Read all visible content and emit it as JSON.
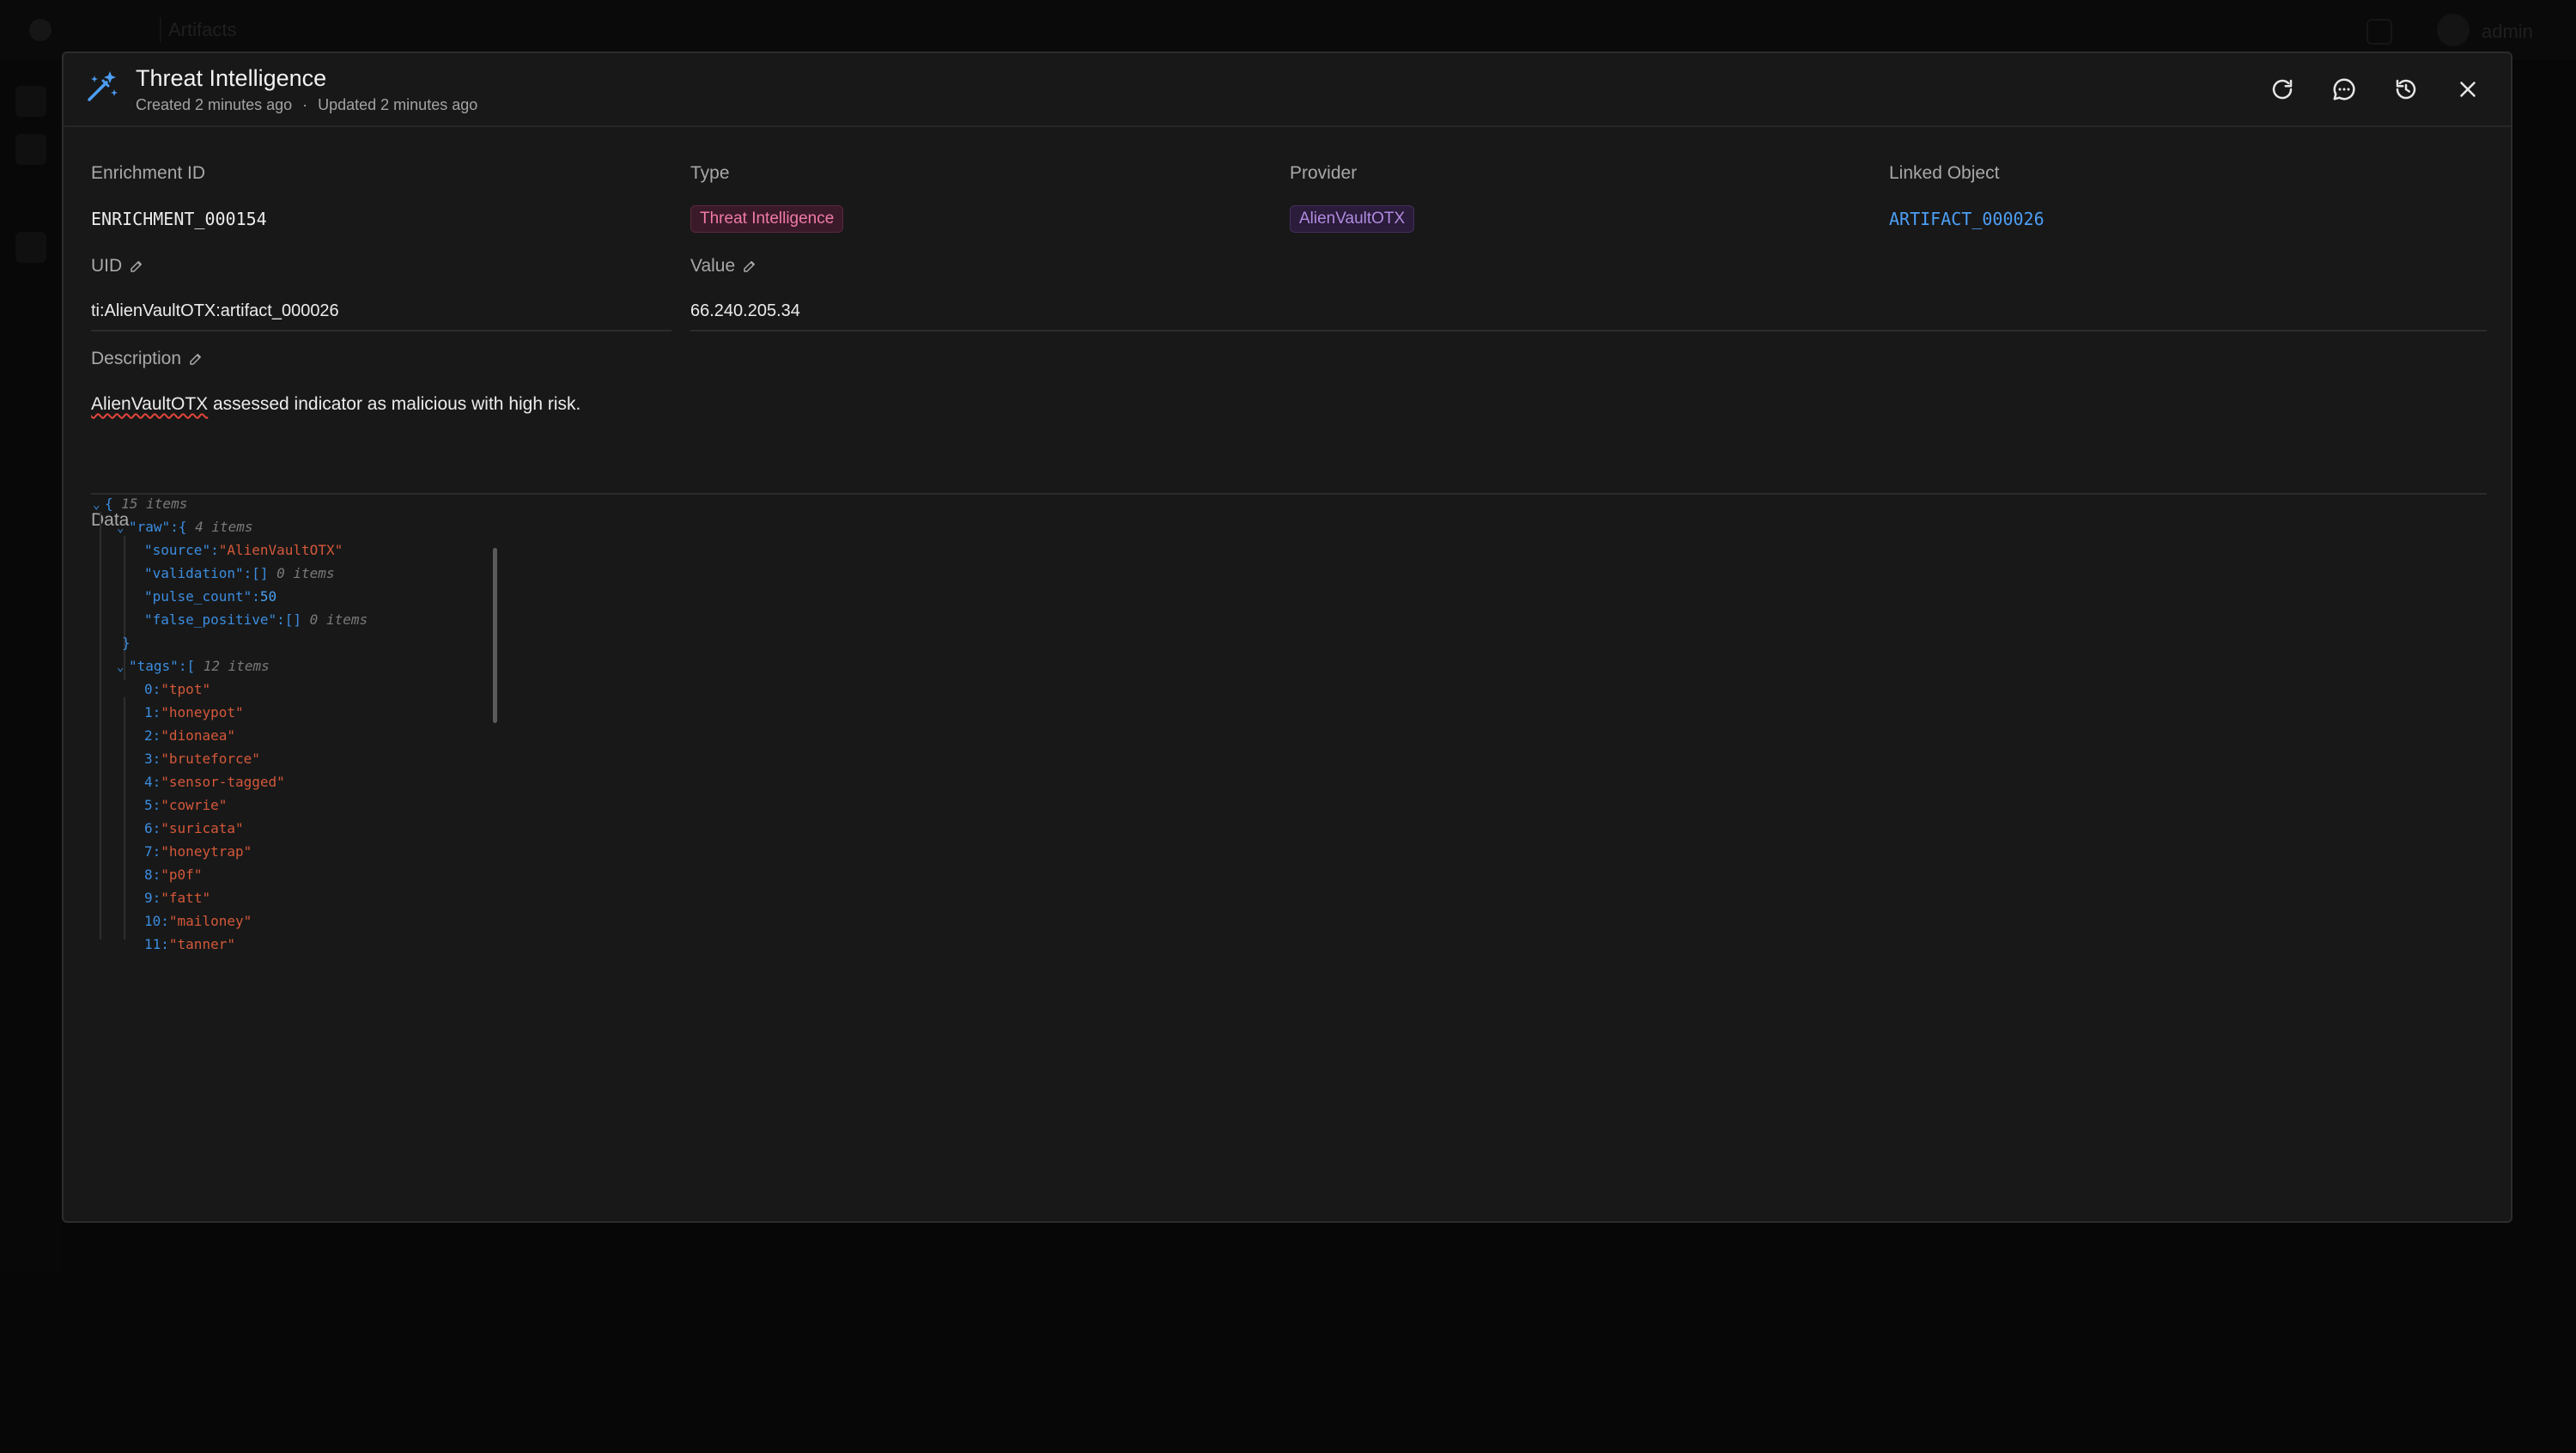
{
  "background": {
    "crumb": "Artifacts",
    "user": "admin"
  },
  "modal": {
    "title": "Threat Intelligence",
    "created": "Created 2 minutes ago",
    "separator": "·",
    "updated": "Updated 2 minutes ago",
    "actions": [
      "refresh-icon",
      "comment-icon",
      "history-icon",
      "close-icon"
    ]
  },
  "fields": {
    "enrichment_id": {
      "label": "Enrichment ID",
      "value": "ENRICHMENT_000154"
    },
    "type": {
      "label": "Type",
      "value": "Threat Intelligence"
    },
    "provider": {
      "label": "Provider",
      "value": "AlienVaultOTX"
    },
    "linked_object": {
      "label": "Linked Object",
      "value": "ARTIFACT_000026"
    },
    "uid": {
      "label": "UID",
      "value": "ti:AlienVaultOTX:artifact_000026"
    },
    "value": {
      "label": "Value",
      "value": "66.240.205.34"
    },
    "description": {
      "label": "Description",
      "value_prefix": "AlienVaultOTX",
      "value_rest": " assessed indicator as malicious with high risk."
    }
  },
  "data_section": {
    "label": "Data",
    "root_meta": "15 items",
    "raw": {
      "key": "raw",
      "meta": "4 items",
      "source_key": "source",
      "source_val": "\"AlienVaultOTX\"",
      "validation_key": "validation",
      "validation_meta": "0 items",
      "pulse_key": "pulse_count",
      "pulse_val": "50",
      "fp_key": "false_positive",
      "fp_meta": "0 items"
    },
    "tags": {
      "key": "tags",
      "meta": "12 items",
      "items": [
        "\"tpot\"",
        "\"honeypot\"",
        "\"dionaea\"",
        "\"bruteforce\"",
        "\"sensor-tagged\"",
        "\"cowrie\"",
        "\"suricata\"",
        "\"honeytrap\"",
        "\"p0f\"",
        "\"fatt\"",
        "\"mailoney\"",
        "\"tanner\""
      ]
    }
  },
  "colors": {
    "accent": "#4d9ef5",
    "type_chip": "#f07aa6",
    "provider_chip": "#b18ae0",
    "json_key": "#3b8de0",
    "json_string": "#d4583a"
  }
}
